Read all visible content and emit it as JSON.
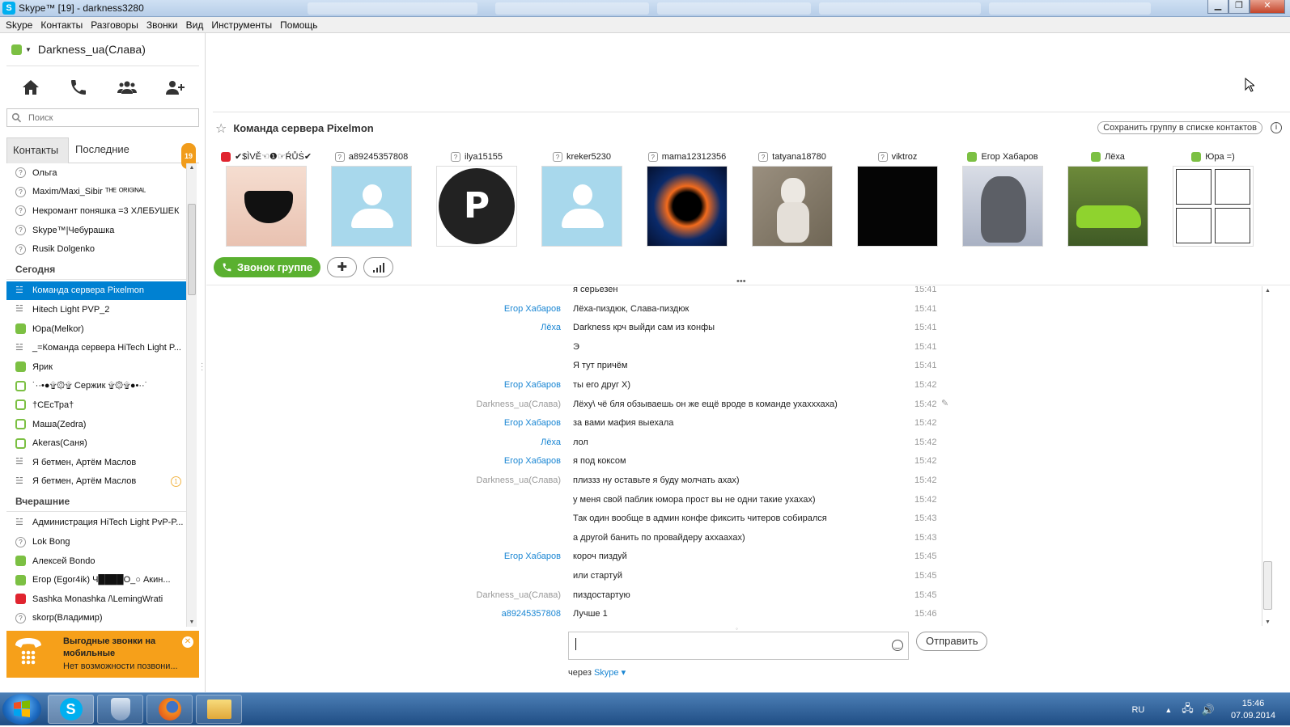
{
  "window": {
    "title": "Skype™ [19] - darkness3280"
  },
  "menu": [
    "Skype",
    "Контакты",
    "Разговоры",
    "Звонки",
    "Вид",
    "Инструменты",
    "Помощь"
  ],
  "user": {
    "name": "Darkness_ua(Слава)"
  },
  "search": {
    "placeholder": "Поиск"
  },
  "tabs": {
    "contacts": "Контакты",
    "recent": "Последние",
    "recent_badge": "19"
  },
  "contacts": [
    {
      "name": "Ольга",
      "status": "unk"
    },
    {
      "name": "Maxim/Maxi_Sibir ᵀᴴᴱ ᴼᴿᴵᴳᴵᴺᴬᴸ",
      "status": "unk"
    },
    {
      "name": "Некромант поняшка =3 ХЛЕБУШЕК",
      "status": "unk"
    },
    {
      "name": "Skype™|Чебурашка",
      "status": "unk"
    },
    {
      "name": "Rusik Dolgenko",
      "status": "unk"
    },
    {
      "header": "Сегодня"
    },
    {
      "name": "Команда сервера Pixelmon",
      "status": "grp",
      "selected": true
    },
    {
      "name": "Hitech Light PVP_2",
      "status": "grp"
    },
    {
      "name": "Юра(Melkor)",
      "status": "on"
    },
    {
      "name": "_=Команда сервера HiTech Light P...",
      "status": "grp"
    },
    {
      "name": "Ярик",
      "status": "on"
    },
    {
      "name": "˙··•●۩۞۩ Сержик ۩۞۩●•··˙",
      "status": "off"
    },
    {
      "name": "†СЕсТра†",
      "status": "off"
    },
    {
      "name": "Маша(Zedra)",
      "status": "off"
    },
    {
      "name": "Akeras(Саня)",
      "status": "off"
    },
    {
      "name": "Я бетмен, Артём Маслов",
      "status": "grp"
    },
    {
      "name": "Я бетмен, Артём Маслов",
      "status": "grp",
      "unread": "1"
    },
    {
      "header": "Вчерашние"
    },
    {
      "name": "Администрация HiTech Light PvP-P...",
      "status": "grp"
    },
    {
      "name": "Lok Bong",
      "status": "unk"
    },
    {
      "name": "Алексей Bondo",
      "status": "on"
    },
    {
      "name": "Егор (Egor4ik) Ч████О_○ Акин...",
      "status": "on"
    },
    {
      "name": "Sashka Monashka /\\LemingWrati",
      "status": "dnd"
    },
    {
      "name": "skorp(Владимир)",
      "status": "unk"
    }
  ],
  "promo": {
    "title": "Выгодные звонки на мобильные",
    "text": "Нет возможности позвони..."
  },
  "group": {
    "name": "Команда сервера Pixelmon",
    "save_label": "Сохранить группу в списке контактов",
    "info": "i",
    "call_label": "Звонок группе"
  },
  "members": [
    {
      "name": "✔$ÌVĚ☜❶☞ŔŮṠ✔",
      "status": "dnd",
      "avatar": "photo"
    },
    {
      "name": "a89245357808",
      "status": "unk",
      "avatar": "blank"
    },
    {
      "name": "ilya15155",
      "status": "unk",
      "avatar": "playstation"
    },
    {
      "name": "kreker5230",
      "status": "unk",
      "avatar": "blank"
    },
    {
      "name": "mama12312356",
      "status": "unk",
      "avatar": "planet"
    },
    {
      "name": "tatyana18780",
      "status": "unk",
      "avatar": "cat"
    },
    {
      "name": "viktroz",
      "status": "unk",
      "avatar": "black"
    },
    {
      "name": "Егор Хабаров",
      "status": "on",
      "avatar": "monster"
    },
    {
      "name": "Лёха",
      "status": "on",
      "avatar": "car"
    },
    {
      "name": "Юра =)",
      "status": "on",
      "avatar": "comic"
    }
  ],
  "messages": [
    {
      "sender": "",
      "text": "я серьезен",
      "time": "15:41"
    },
    {
      "sender": "Егор Хабаров",
      "sc": "blue",
      "text": "Лёха-пиздюк, Слава-пиздюк",
      "time": "15:41"
    },
    {
      "sender": "Лёха",
      "sc": "blue",
      "text": "Darkness крч выйди сам из конфы",
      "time": "15:41"
    },
    {
      "sender": "",
      "text": "Э",
      "time": "15:41"
    },
    {
      "sender": "",
      "text": "Я тут причём",
      "time": "15:41"
    },
    {
      "sender": "Егор Хабаров",
      "sc": "blue",
      "text": "ты его друг Х)",
      "time": "15:42"
    },
    {
      "sender": "Darkness_ua(Слава)",
      "sc": "gray",
      "text": "Лёху\\ чё бля обзываешь он же ещё вроде в команде ухахххаха)",
      "time": "15:42",
      "edited": "✎"
    },
    {
      "sender": "Егор Хабаров",
      "sc": "blue",
      "text": "за вами мафия выехала",
      "time": "15:42"
    },
    {
      "sender": "Лёха",
      "sc": "blue",
      "text": "лол",
      "time": "15:42"
    },
    {
      "sender": "Егор Хабаров",
      "sc": "blue",
      "text": "я под коксом",
      "time": "15:42"
    },
    {
      "sender": "Darkness_ua(Слава)",
      "sc": "gray",
      "text": "плиззз ну оставьте я буду молчать ахах)",
      "time": "15:42"
    },
    {
      "sender": "",
      "text": "у меня свой паблик юмора прост вы не одни такие ухахах)",
      "time": "15:42"
    },
    {
      "sender": "",
      "text": "Так один вообще в админ конфе фиксить читеров собирался",
      "time": "15:43"
    },
    {
      "sender": "",
      "text": "а другой банить по провайдеру аххаахах)",
      "time": "15:43"
    },
    {
      "sender": "Егор Хабаров",
      "sc": "blue",
      "text": "короч пиздуй",
      "time": "15:45"
    },
    {
      "sender": "",
      "text": "или стартуй",
      "time": "15:45"
    },
    {
      "sender": "Darkness_ua(Слава)",
      "sc": "gray",
      "text": "пиздостартую",
      "time": "15:45"
    },
    {
      "sender": "a89245357808",
      "sc": "blue",
      "text": "Лучше 1",
      "time": "15:46"
    }
  ],
  "compose": {
    "value": "",
    "send_label": "Отправить",
    "via_prefix": "через",
    "via_service": "Skype ▾"
  },
  "taskbar": {
    "lang": "RU",
    "time": "15:46",
    "date": "07.09.2014"
  }
}
